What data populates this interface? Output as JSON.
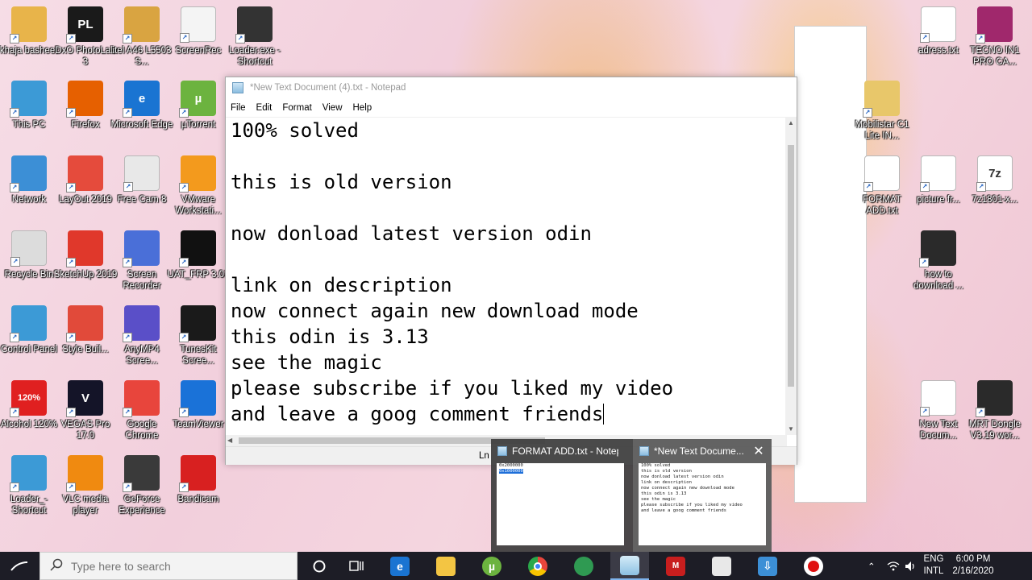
{
  "desktop": {
    "icons": [
      {
        "label": "khaja basheer",
        "icon": "user-folder-icon",
        "color": "#e8b44a"
      },
      {
        "label": "DxO PhotoLab 3",
        "icon": "dxo-photolab-icon",
        "color": "#1a1a1a",
        "glyph": "PL"
      },
      {
        "label": "itel A46 L5503 S...",
        "icon": "folder-icon",
        "color": "#d9a441"
      },
      {
        "label": "ScreenRec",
        "icon": "screenrec-icon",
        "color": "#f4f4f4"
      },
      {
        "label": "Loader.exe - Shortcut",
        "icon": "loader-icon",
        "color": "#333333"
      },
      {
        "label": "This PC",
        "icon": "this-pc-icon",
        "color": "#3c9ad6"
      },
      {
        "label": "Firefox",
        "icon": "firefox-icon",
        "color": "#e66000"
      },
      {
        "label": "Microsoft Edge",
        "icon": "edge-icon",
        "color": "#1a74d2",
        "glyph": "e"
      },
      {
        "label": "µTorrent",
        "icon": "utorrent-icon",
        "color": "#6cb33f",
        "glyph": "µ"
      },
      {
        "label": "Network",
        "icon": "network-icon",
        "color": "#3c8fd6"
      },
      {
        "label": "LayOut 2019",
        "icon": "layout-icon",
        "color": "#e54b3c"
      },
      {
        "label": "Free Cam 8",
        "icon": "free-cam-icon",
        "color": "#e8e8e8"
      },
      {
        "label": "VMware Workstati...",
        "icon": "vmware-icon",
        "color": "#f39a1d"
      },
      {
        "label": "Recycle Bin",
        "icon": "recycle-bin-icon",
        "color": "#dcdcdc"
      },
      {
        "label": "SketchUp 2019",
        "icon": "sketchup-icon",
        "color": "#e0382b"
      },
      {
        "label": "Screen Recorder",
        "icon": "screen-recorder-icon",
        "color": "#4a6fd8"
      },
      {
        "label": "UAT_FRP 3.01",
        "icon": "uat-frp-icon",
        "color": "#111111"
      },
      {
        "label": "Control Panel",
        "icon": "control-panel-icon",
        "color": "#3c9ad6"
      },
      {
        "label": "Style Buil...",
        "icon": "style-builder-icon",
        "color": "#e14a3a"
      },
      {
        "label": "AnyMP4 Scree...",
        "icon": "anymp4-icon",
        "color": "#5a4fc8"
      },
      {
        "label": "TunesKit Scree...",
        "icon": "tuneskit-icon",
        "color": "#1a1a1a"
      },
      {
        "label": "Alcohol 120%",
        "icon": "alcohol-icon",
        "color": "#e02020",
        "glyph": "120%"
      },
      {
        "label": "VEGAS Pro 17.0",
        "icon": "vegas-icon",
        "color": "#141428",
        "glyph": "V"
      },
      {
        "label": "Google Chrome",
        "icon": "chrome-icon",
        "color": "#e8453c"
      },
      {
        "label": "TeamViewer",
        "icon": "teamviewer-icon",
        "color": "#1a72d8"
      },
      {
        "label": "Loader_-Shortcut",
        "icon": "loader-shortcut-icon",
        "color": "#3c9ad6"
      },
      {
        "label": "VLC media player",
        "icon": "vlc-icon",
        "color": "#f08a10"
      },
      {
        "label": "GeForce Experience",
        "icon": "geforce-icon",
        "color": "#3a3a3a"
      },
      {
        "label": "Bandicam",
        "icon": "bandicam-icon",
        "color": "#d82020"
      },
      {
        "label": "adress.txt",
        "icon": "text-file-icon",
        "color": "#ffffff"
      },
      {
        "label": "TECNO IN1 PRO CA...",
        "icon": "winrar-icon",
        "color": "#a0286c"
      },
      {
        "label": "Mobilistar C1 Lite IN...",
        "icon": "folder-icon",
        "color": "#e8c76a"
      },
      {
        "label": "FORMAT ADD.txt",
        "icon": "text-file-icon",
        "color": "#ffffff"
      },
      {
        "label": "picture fr...",
        "icon": "picture-icon",
        "color": "#ffffff"
      },
      {
        "label": "7z1801-x...",
        "icon": "7zip-icon",
        "color": "#ffffff",
        "glyph": "7z"
      },
      {
        "label": "how to download ...",
        "icon": "video-file-icon",
        "color": "#2a2a2a"
      },
      {
        "label": "New Text Docum...",
        "icon": "text-file-icon",
        "color": "#ffffff"
      },
      {
        "label": "MRT Dongle V3.19 wor...",
        "icon": "video-file-icon",
        "color": "#2a2a2a"
      }
    ]
  },
  "notepad": {
    "title": "*New Text Document (4).txt - Notepad",
    "menu": [
      "File",
      "Edit",
      "Format",
      "View",
      "Help"
    ],
    "lines": [
      "100% solved",
      "",
      "this is old version",
      "",
      "now donload latest version odin",
      "",
      "link on description",
      "now connect again new download mode",
      "this odin is 3.13",
      "see the magic",
      "please subscribe if you liked my video",
      "and leave a goog comment friends"
    ],
    "status": "Ln"
  },
  "taskbar_preview": {
    "items": [
      {
        "title": "FORMAT ADD.txt - Notep...",
        "preview_lines": [
          "0x2000000",
          "",
          "0x1000000"
        ]
      },
      {
        "title": "*New Text Docume...",
        "preview_lines": [
          "100% solved",
          "",
          "this is old version",
          "",
          "now donload latest version odin",
          "",
          "link on description",
          "now connect again new download mode",
          "this odin is 3.13",
          "see the magic",
          "please subscribe if you liked my video",
          "and leave a goog comment friends"
        ]
      }
    ],
    "close_glyph": "✕"
  },
  "taskbar": {
    "search_placeholder": "Type here to search",
    "language_top": "ENG",
    "language_bottom": "INTL",
    "time": "6:00 PM",
    "date": "2/16/2020"
  }
}
